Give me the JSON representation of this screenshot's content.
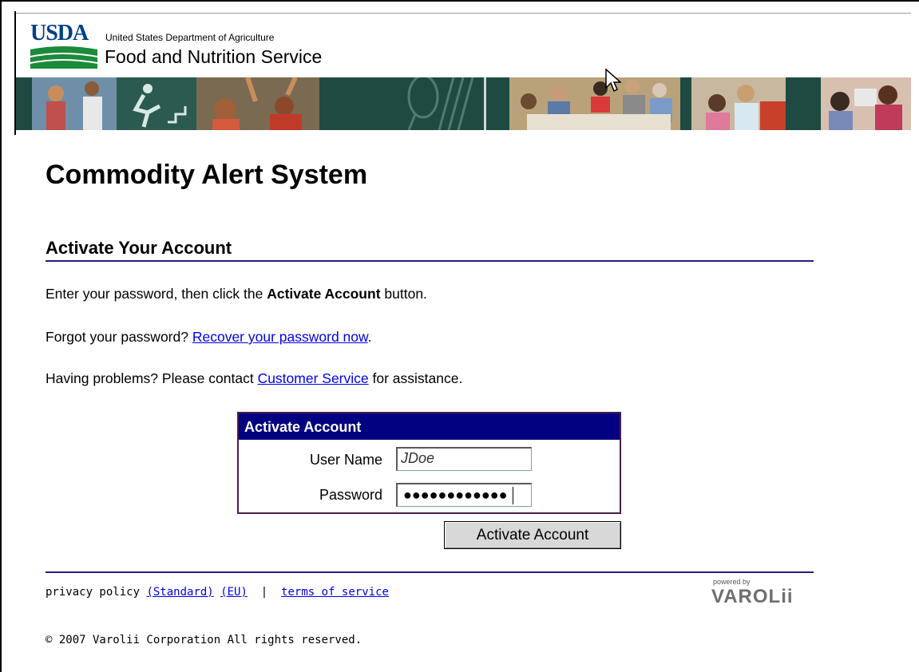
{
  "header": {
    "logo_text": "USDA",
    "department": "United States Department of Agriculture",
    "agency": "Food and Nutrition Service"
  },
  "page": {
    "title": "Commodity Alert System",
    "section_title": "Activate Your Account",
    "instruction_prefix": "Enter your password, then click the ",
    "instruction_bold": "Activate Account",
    "instruction_suffix": " button.",
    "forgot_prefix": "Forgot your password? ",
    "forgot_link": "Recover your password now",
    "forgot_suffix": ".",
    "problems_prefix": "Having problems? Please contact ",
    "problems_link": "Customer Service",
    "problems_suffix": " for assistance."
  },
  "form": {
    "title": "Activate Account",
    "username_label": "User Name",
    "username_value": "JDoe",
    "password_label": "Password",
    "password_mask": "●●●●●●●●●●●●",
    "submit_label": "Activate Account"
  },
  "footer": {
    "privacy_label": "privacy policy",
    "privacy_standard": "(Standard)",
    "privacy_eu": "(EU)",
    "separator": "|",
    "terms": "terms of service",
    "powered_by": "powered by",
    "brand": "VAROLii",
    "copyright": "© 2007 Varolii Corporation All rights reserved."
  },
  "colors": {
    "banner": "#1e4a42",
    "form_header": "#000080",
    "rule": "#1e1e7e",
    "link": "#0000ee"
  }
}
